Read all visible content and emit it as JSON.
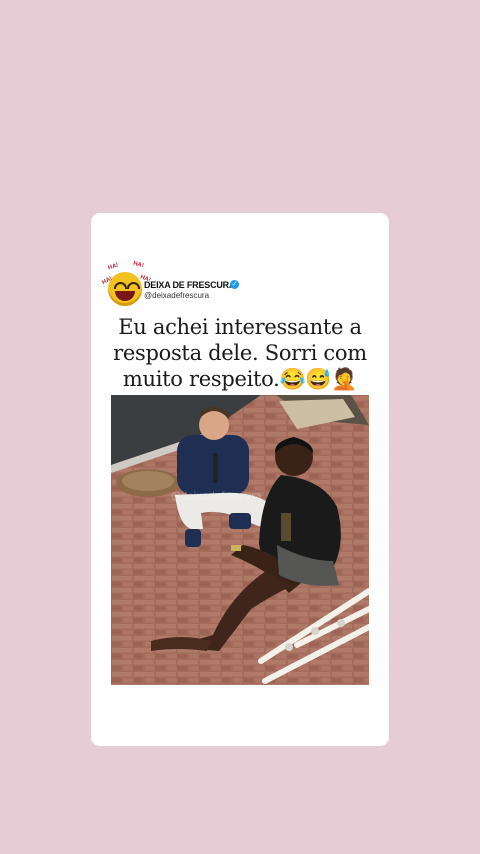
{
  "post": {
    "account_name": "DEIXA DE FRESCURA",
    "account_handle": "@deixadefrescura",
    "verified_icon": "✓",
    "logo_sticker_text": [
      "HA!",
      "HA!",
      "HA!",
      "HA!"
    ],
    "caption_lines": [
      "Eu achei interessante a",
      "resposta dele. Sorri com",
      "muito respeito.😂😅🤦"
    ],
    "photo_watermark": "@deixadefrescura",
    "photo_description_icon": "street-interview-photo"
  },
  "colors": {
    "background": "#e6cdd5",
    "card": "#ffffff",
    "verified": "#1d9bf0",
    "text": "#1a1a1a"
  }
}
